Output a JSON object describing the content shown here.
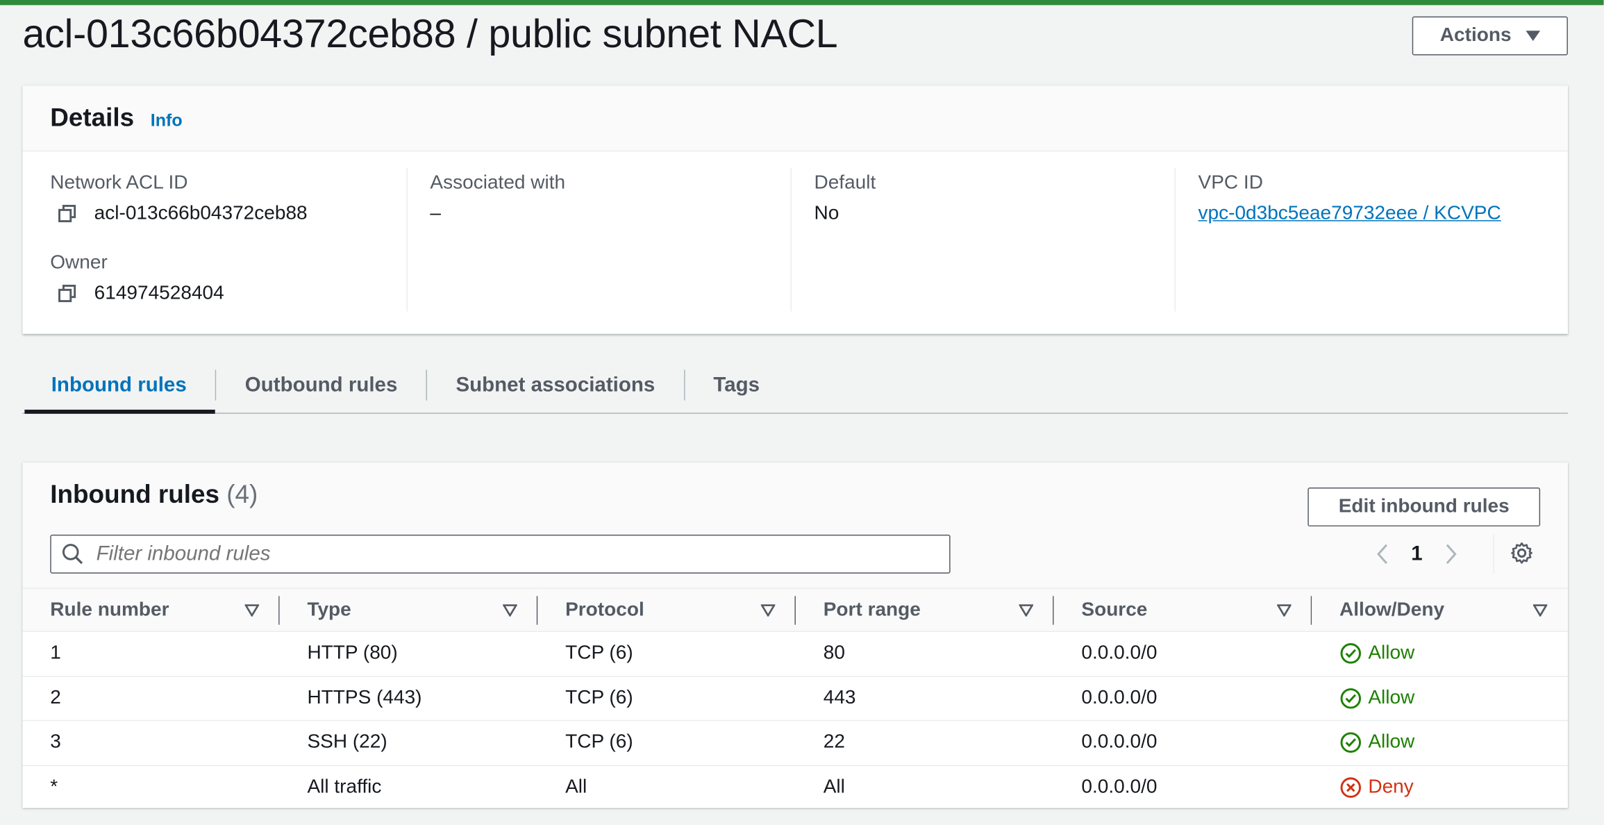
{
  "page": {
    "title": "acl-013c66b04372ceb88 / public subnet NACL",
    "actions_label": "Actions"
  },
  "details": {
    "heading": "Details",
    "info_link": "Info",
    "fields": {
      "network_acl_id_label": "Network ACL ID",
      "network_acl_id_value": "acl-013c66b04372ceb88",
      "owner_label": "Owner",
      "owner_value": "614974528404",
      "associated_label": "Associated with",
      "associated_value": "–",
      "default_label": "Default",
      "default_value": "No",
      "vpc_label": "VPC ID",
      "vpc_value": "vpc-0d3bc5eae79732eee / KCVPC"
    }
  },
  "tabs": [
    {
      "label": "Inbound rules",
      "active": true
    },
    {
      "label": "Outbound rules",
      "active": false
    },
    {
      "label": "Subnet associations",
      "active": false
    },
    {
      "label": "Tags",
      "active": false
    }
  ],
  "inbound": {
    "title": "Inbound rules",
    "count": "(4)",
    "edit_label": "Edit inbound rules",
    "filter_placeholder": "Filter inbound rules",
    "page": "1",
    "columns": [
      "Rule number",
      "Type",
      "Protocol",
      "Port range",
      "Source",
      "Allow/Deny"
    ],
    "rows": [
      {
        "rule": "1",
        "type": "HTTP (80)",
        "protocol": "TCP (6)",
        "port": "80",
        "source": "0.0.0.0/0",
        "action": "Allow"
      },
      {
        "rule": "2",
        "type": "HTTPS (443)",
        "protocol": "TCP (6)",
        "port": "443",
        "source": "0.0.0.0/0",
        "action": "Allow"
      },
      {
        "rule": "3",
        "type": "SSH (22)",
        "protocol": "TCP (6)",
        "port": "22",
        "source": "0.0.0.0/0",
        "action": "Allow"
      },
      {
        "rule": "*",
        "type": "All traffic",
        "protocol": "All",
        "port": "All",
        "source": "0.0.0.0/0",
        "action": "Deny"
      }
    ]
  },
  "colors": {
    "top_bar": "#2e8b3a",
    "link": "#0073bb",
    "allow": "#1d8102",
    "deny": "#d13212"
  },
  "icons": [
    "copy-icon",
    "caret-down-icon",
    "search-icon",
    "chevron-left-icon",
    "chevron-right-icon",
    "settings-gear-icon",
    "sort-icon",
    "check-circle-icon",
    "x-circle-icon"
  ]
}
